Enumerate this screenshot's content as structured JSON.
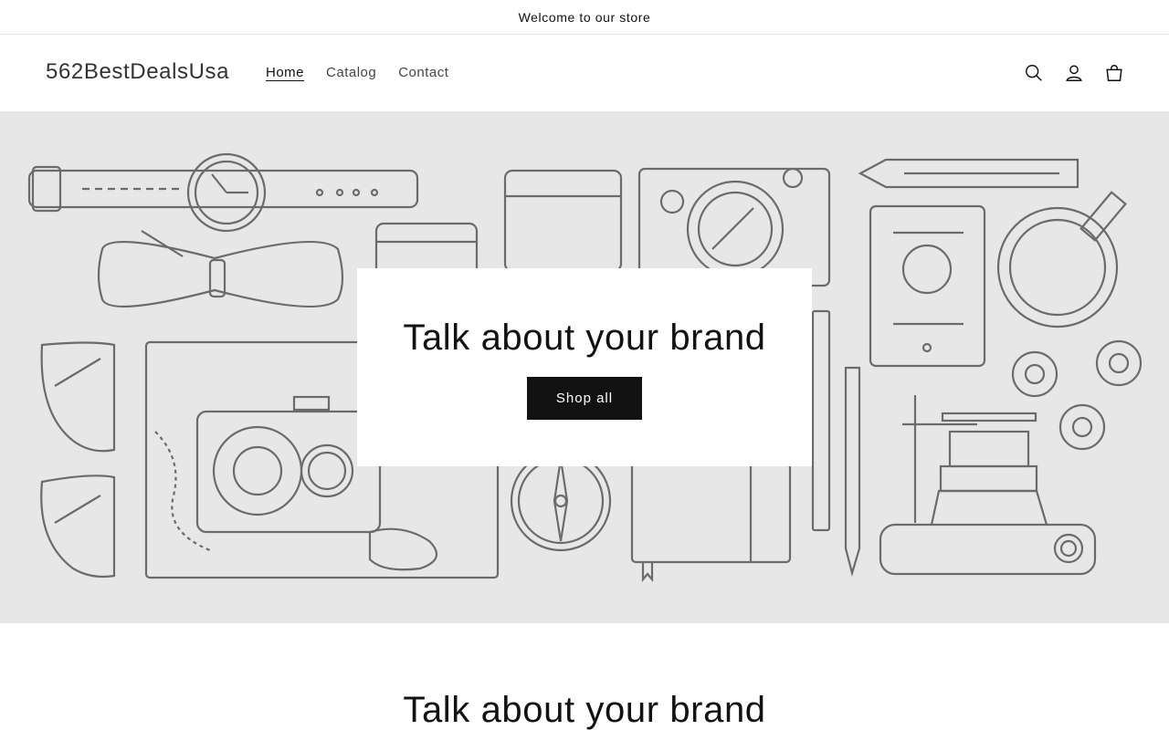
{
  "announcement": {
    "text": "Welcome to our store"
  },
  "header": {
    "logo": "562BestDealsUsa",
    "nav": [
      {
        "label": "Home",
        "active": true
      },
      {
        "label": "Catalog",
        "active": false
      },
      {
        "label": "Contact",
        "active": false
      }
    ],
    "icons": [
      "search-icon",
      "account-icon",
      "cart-icon"
    ]
  },
  "hero": {
    "title": "Talk about your brand",
    "button_label": "Shop all",
    "background_color": "#e7e7e7",
    "illustration_stroke": "#6b6b6b"
  },
  "section": {
    "title": "Talk about your brand"
  },
  "colors": {
    "text": "#121212",
    "button_bg": "#121212",
    "button_text": "#ffffff"
  }
}
